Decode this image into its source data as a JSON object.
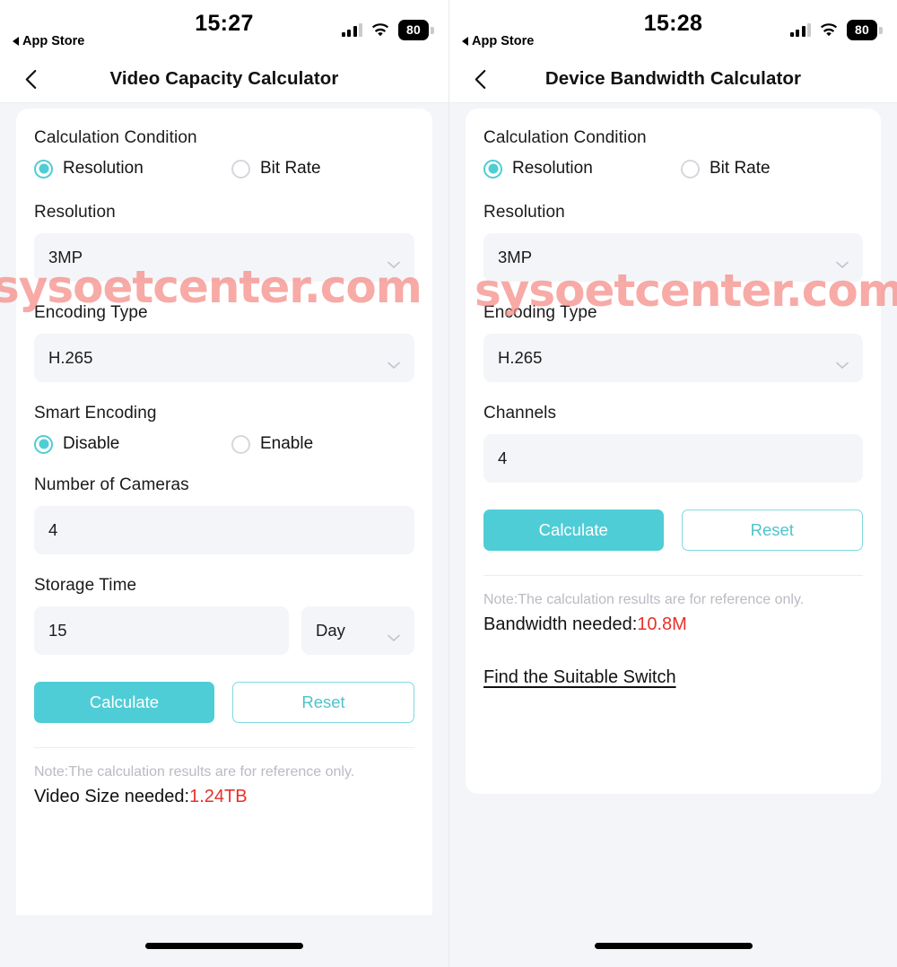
{
  "watermark": "sysoetcenter.com",
  "accent": "#4fcdd6",
  "result_color": "#e8302a",
  "left": {
    "status": {
      "time": "15:27",
      "back_app": "App Store",
      "battery": "80"
    },
    "nav": {
      "back_icon": "chevron-left-icon",
      "title": "Video Capacity Calculator"
    },
    "condition": {
      "label": "Calculation Condition",
      "options": [
        {
          "label": "Resolution",
          "selected": true
        },
        {
          "label": "Bit Rate",
          "selected": false
        }
      ]
    },
    "resolution": {
      "label": "Resolution",
      "value": "3MP"
    },
    "encoding": {
      "label": "Encoding Type",
      "value": "H.265"
    },
    "smart_encoding": {
      "label": "Smart Encoding",
      "options": [
        {
          "label": "Disable",
          "selected": true
        },
        {
          "label": "Enable",
          "selected": false
        }
      ]
    },
    "cameras": {
      "label": "Number of Cameras",
      "value": "4"
    },
    "storage_time": {
      "label": "Storage Time",
      "value": "15",
      "unit": "Day"
    },
    "buttons": {
      "calculate": "Calculate",
      "reset": "Reset"
    },
    "note": "Note:The calculation results are for reference only.",
    "result": {
      "label": "Video Size needed:",
      "value": "1.24TB"
    }
  },
  "right": {
    "status": {
      "time": "15:28",
      "back_app": "App Store",
      "battery": "80"
    },
    "nav": {
      "back_icon": "chevron-left-icon",
      "title": "Device Bandwidth Calculator"
    },
    "condition": {
      "label": "Calculation Condition",
      "options": [
        {
          "label": "Resolution",
          "selected": true
        },
        {
          "label": "Bit Rate",
          "selected": false
        }
      ]
    },
    "resolution": {
      "label": "Resolution",
      "value": "3MP"
    },
    "encoding": {
      "label": "Encoding Type",
      "value": "H.265"
    },
    "channels": {
      "label": "Channels",
      "value": "4"
    },
    "buttons": {
      "calculate": "Calculate",
      "reset": "Reset"
    },
    "note": "Note:The calculation results are for reference only.",
    "result": {
      "label": "Bandwidth needed:",
      "value": "10.8M"
    },
    "switch_link": "Find the Suitable Switch"
  }
}
